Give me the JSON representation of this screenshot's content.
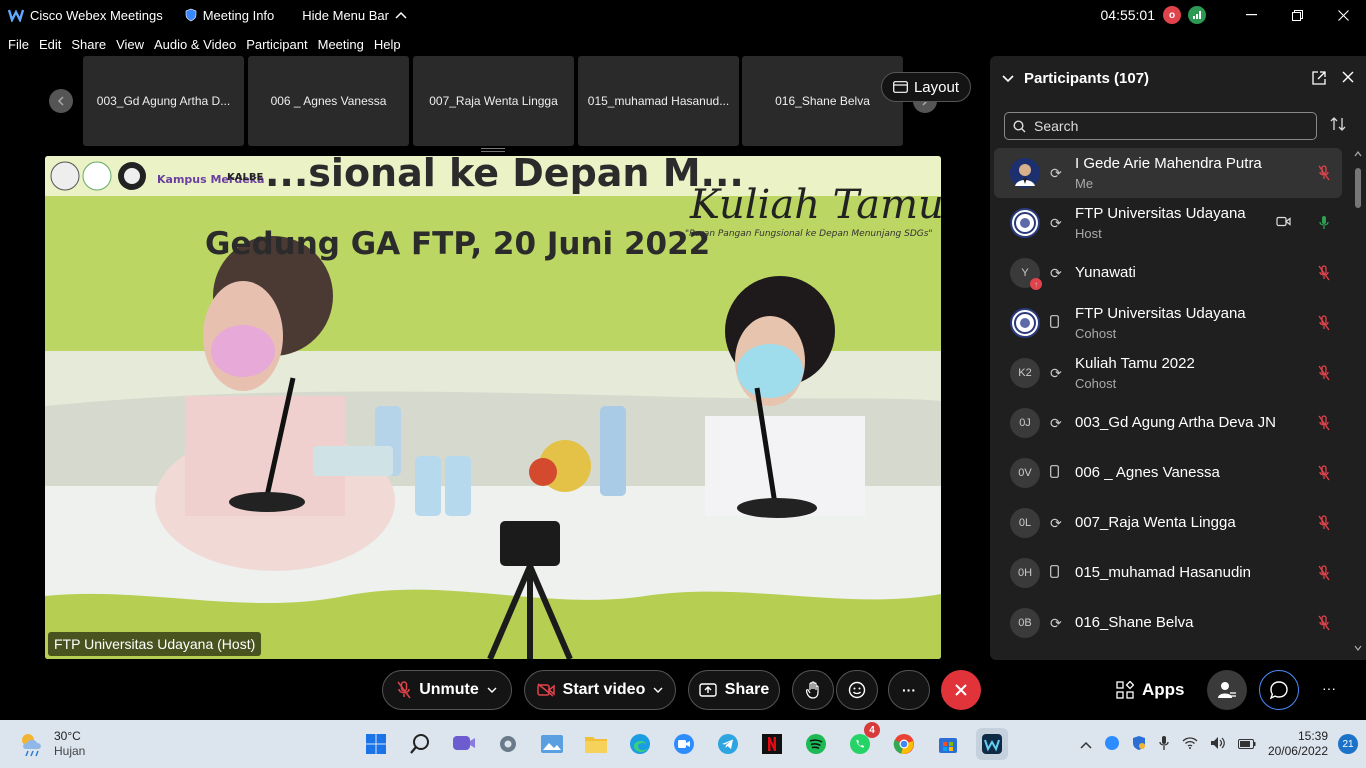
{
  "titlebar": {
    "app_name": "Cisco Webex Meetings",
    "meeting_info": "Meeting Info",
    "hide_menu_bar": "Hide Menu Bar",
    "clock": "04:55:01",
    "record_badge": "o"
  },
  "menu": [
    "File",
    "Edit",
    "Share",
    "View",
    "Audio & Video",
    "Participant",
    "Meeting",
    "Help"
  ],
  "thumbnails": [
    "003_Gd Agung Artha D...",
    "006 _ Agnes Vanessa",
    "007_Raja Wenta Lingga",
    "015_muhamad Hasanud...",
    "016_Shane Belva"
  ],
  "layout_button": "Layout",
  "main_video": {
    "label": "FTP Universitas Udayana (Host)",
    "banner_line1": "...sional ke Depan M...",
    "banner_line2": "Gedung GA FTP, 20 Juni 2022",
    "banner_title": "Kuliah Tamu",
    "banner_subtitle": "\"Peran Pangan Fungsional ke Depan Menunjang SDGs\"",
    "logo_text": "Kampus Merdeka",
    "sponsor_text": "KALBE"
  },
  "participants_panel": {
    "title": "Participants (107)",
    "search_placeholder": "Search",
    "items": [
      {
        "name": "I Gede Arie Mahendra Putra",
        "role": "Me",
        "initials": "",
        "device": "headset",
        "muted": true
      },
      {
        "name": "FTP Universitas Udayana",
        "role": "Host",
        "initials": "",
        "device": "headset",
        "muted": false
      },
      {
        "name": "Yunawati",
        "role": "",
        "initials": "Y",
        "device": "headset",
        "muted": true
      },
      {
        "name": "FTP Universitas Udayana",
        "role": "Cohost",
        "initials": "",
        "device": "phone",
        "muted": true
      },
      {
        "name": "Kuliah Tamu 2022",
        "role": "Cohost",
        "initials": "K2",
        "device": "headset",
        "muted": true
      },
      {
        "name": "003_Gd Agung Artha Deva JN",
        "role": "",
        "initials": "0J",
        "device": "headset",
        "muted": true
      },
      {
        "name": "006 _ Agnes Vanessa",
        "role": "",
        "initials": "0V",
        "device": "phone",
        "muted": true
      },
      {
        "name": "007_Raja Wenta Lingga",
        "role": "",
        "initials": "0L",
        "device": "headset",
        "muted": true
      },
      {
        "name": "015_muhamad Hasanudin",
        "role": "",
        "initials": "0H",
        "device": "phone",
        "muted": true
      },
      {
        "name": "016_Shane Belva",
        "role": "",
        "initials": "0B",
        "device": "headset",
        "muted": true
      }
    ]
  },
  "controls": {
    "unmute": "Unmute",
    "start_video": "Start video",
    "share": "Share",
    "more": "···",
    "apps": "Apps",
    "overflow": "···"
  },
  "taskbar": {
    "weather_temp": "30°C",
    "weather_desc": "Hujan",
    "whatsapp_badge": "4",
    "time": "15:39",
    "date": "20/06/2022",
    "notifications": "21"
  },
  "colors": {
    "accent_red": "#e0434b",
    "accent_green": "#2ba052",
    "panel_bg": "#1f1f1f",
    "taskbar_bg": "#dce4ee"
  }
}
